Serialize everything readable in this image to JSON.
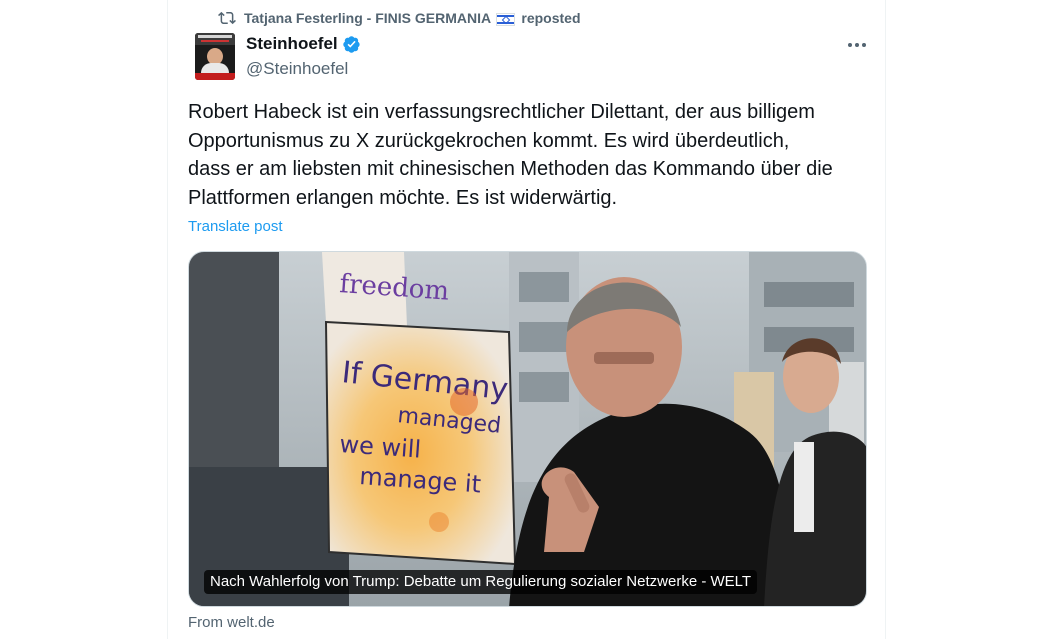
{
  "repost": {
    "icon": "repost-icon",
    "user": "Tatjana Festerling - FINIS GERMANIA",
    "flag_icon": "israel-flag-icon",
    "suffix": "reposted"
  },
  "author": {
    "display_name": "Steinhoefel",
    "handle": "@Steinhoefel",
    "verified": true,
    "verified_color": "#1d9bf0"
  },
  "post": {
    "text": "Robert Habeck ist ein verfassungsrechtlicher Dilettant, der aus billigem\nOpportunismus zu X zurückgekrochen kommt. Es wird überdeutlich,\ndass er am liebsten mit chinesischen Methoden das Kommando über die\nPlattformen erlangen möchte. Es ist widerwärtig.",
    "translate_label": "Translate post"
  },
  "card": {
    "caption": "Nach Wahlerfolg von Trump: Debatte um Regulierung sozialer Netzwerke - WELT",
    "source": "From welt.de",
    "image_sign_text": [
      "freedom",
      "If Germany",
      "managed",
      "we will",
      "manage it"
    ]
  },
  "colors": {
    "text": "#0f1419",
    "muted": "#536471",
    "accent": "#1d9bf0"
  }
}
